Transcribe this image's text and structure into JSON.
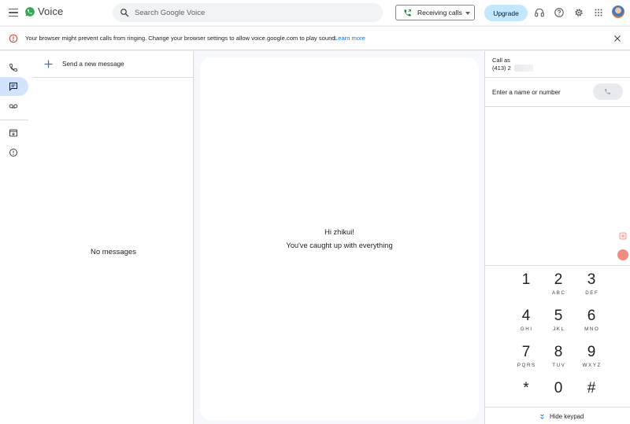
{
  "app": {
    "title": "Voice"
  },
  "header": {
    "search_placeholder": "Search Google Voice",
    "receiving_calls_label": "Receiving calls",
    "upgrade_label": "Upgrade",
    "icons": [
      "menu-icon",
      "voice-logo-icon",
      "search-icon",
      "phone-icon",
      "chevron-down-icon",
      "headset-icon",
      "help-icon",
      "settings-icon",
      "apps-grid-icon",
      "avatar"
    ]
  },
  "banner": {
    "message": "Your browser might prevent calls from ringing. Change your browser settings to allow voice.google.com to play sound.",
    "link_label": "Learn more",
    "icons": [
      "warning-icon",
      "close-icon"
    ]
  },
  "rail": {
    "items": [
      {
        "name": "calls",
        "icon": "phone-icon",
        "active": false
      },
      {
        "name": "messages",
        "icon": "message-icon",
        "active": true
      },
      {
        "name": "voicemail",
        "icon": "voicemail-icon",
        "active": false
      },
      {
        "name": "archive",
        "icon": "archive-icon",
        "active": false
      },
      {
        "name": "spam",
        "icon": "spam-icon",
        "active": false
      }
    ]
  },
  "messages_panel": {
    "new_message_label": "Send a new message",
    "empty_label": "No messages"
  },
  "conversation": {
    "greeting": "Hi zhikui!",
    "status": "You've caught up with everything"
  },
  "dialer": {
    "call_as_label": "Call as",
    "call_as_number": "(413) 2",
    "input_placeholder": "Enter a name or number",
    "keys": [
      {
        "digit": "1",
        "letters": ""
      },
      {
        "digit": "2",
        "letters": "ABC"
      },
      {
        "digit": "3",
        "letters": "DEF"
      },
      {
        "digit": "4",
        "letters": "GHI"
      },
      {
        "digit": "5",
        "letters": "JKL"
      },
      {
        "digit": "6",
        "letters": "MNO"
      },
      {
        "digit": "7",
        "letters": "PQRS"
      },
      {
        "digit": "8",
        "letters": "TUV"
      },
      {
        "digit": "9",
        "letters": "WXYZ"
      },
      {
        "digit": "*",
        "letters": ""
      },
      {
        "digit": "0",
        "letters": ""
      },
      {
        "digit": "#",
        "letters": ""
      }
    ],
    "hide_keypad_label": "Hide keypad"
  },
  "colors": {
    "accent": "#1a73e8",
    "active_nav": "#d3e3fd",
    "upgrade_bg": "#c2e7ff",
    "warning": "#d93025",
    "call_green": "#188038"
  }
}
